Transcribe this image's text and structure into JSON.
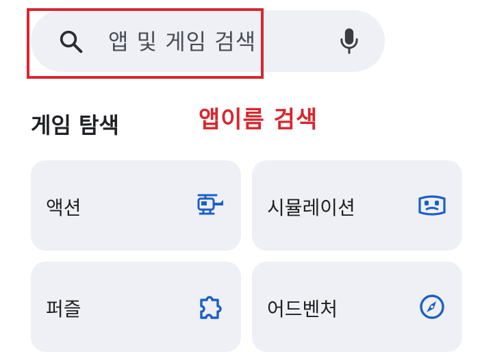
{
  "search": {
    "placeholder": "앱 및 게임 검색"
  },
  "annotation": "앱이름 검색",
  "section": {
    "title": "게임 탐색"
  },
  "categories": [
    {
      "label": "액션",
      "icon": "helicopter-icon"
    },
    {
      "label": "시뮬레이션",
      "icon": "vr-headset-icon"
    },
    {
      "label": "퍼즐",
      "icon": "puzzle-piece-icon"
    },
    {
      "label": "어드벤처",
      "icon": "compass-icon"
    }
  ],
  "colors": {
    "accent": "#1a5fc6",
    "highlight": "#d8262d",
    "card_bg": "#eef0f6"
  }
}
